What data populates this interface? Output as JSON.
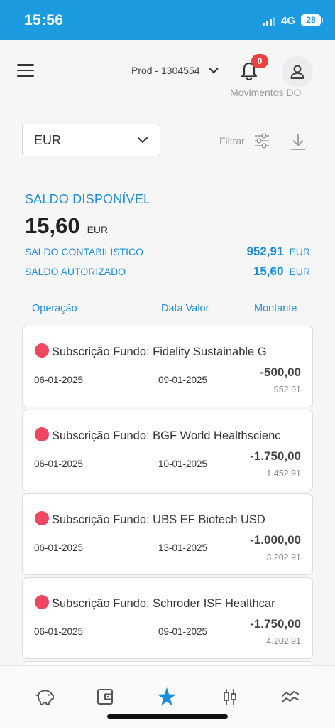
{
  "status_bar": {
    "time": "15:56",
    "network": "4G",
    "battery": "28"
  },
  "header": {
    "account": "Prod - 1304554",
    "notifications_count": "0",
    "caption": "Movimentos DO"
  },
  "toolbar": {
    "currency": "EUR",
    "filter_label": "Filtrar"
  },
  "balances": {
    "available_label": "SALDO DISPONÍVEL",
    "available_amount": "15,60",
    "available_currency": "EUR",
    "accounting_label": "SALDO CONTABILÍSTICO",
    "accounting_amount": "952,91",
    "accounting_currency": "EUR",
    "authorized_label": "SALDO AUTORIZADO",
    "authorized_amount": "15,60",
    "authorized_currency": "EUR"
  },
  "columns": {
    "operation": "Operação",
    "value_date": "Data Valor",
    "amount": "Montante"
  },
  "transactions": [
    {
      "description": "Subscrição Fundo: Fidelity Sustainable G",
      "date": "06-01-2025",
      "value_date": "09-01-2025",
      "amount": "-500,00",
      "balance": "952,91"
    },
    {
      "description": "Subscrição Fundo: BGF World Healthscienc",
      "date": "06-01-2025",
      "value_date": "10-01-2025",
      "amount": "-1.750,00",
      "balance": "1.452,91"
    },
    {
      "description": "Subscrição Fundo: UBS EF Biotech USD",
      "date": "06-01-2025",
      "value_date": "13-01-2025",
      "amount": "-1.000,00",
      "balance": "3.202,91"
    },
    {
      "description": "Subscrição Fundo: Schroder ISF Healthcar",
      "date": "06-01-2025",
      "value_date": "09-01-2025",
      "amount": "-1.750,00",
      "balance": "4.202,91"
    }
  ],
  "bottom_nav": [
    {
      "icon": "piggy-bank-icon"
    },
    {
      "icon": "wallet-icon"
    },
    {
      "icon": "star-logo-icon"
    },
    {
      "icon": "candlestick-icon"
    },
    {
      "icon": "trend-waves-icon"
    }
  ],
  "colors": {
    "status_bar": "#1d9be0",
    "accent": "#1d8dd6",
    "badge": "#e8433f",
    "pending_dot": "#ee4762"
  }
}
